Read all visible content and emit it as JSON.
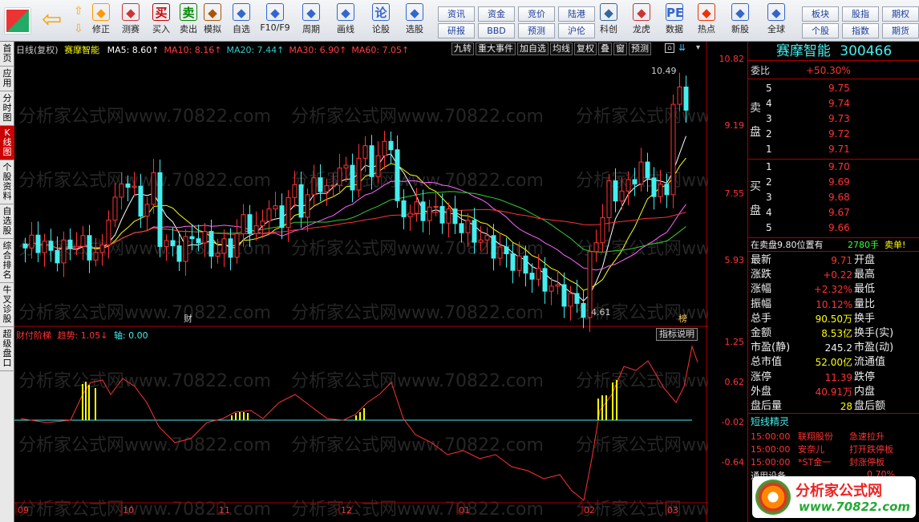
{
  "toolbar": {
    "big": [
      {
        "label": "修正",
        "icon": "sun-icon"
      },
      {
        "label": "测赛",
        "icon": "clock-icon"
      },
      {
        "label": "买入",
        "icon": "buy-icon",
        "glyph": "买"
      },
      {
        "label": "卖出",
        "icon": "sell-icon",
        "glyph": "卖"
      },
      {
        "label": "模拟",
        "icon": "hammer-icon"
      },
      {
        "label": "自选",
        "icon": "star-icon"
      },
      {
        "label": "F10/F9",
        "icon": "f10-icon"
      },
      {
        "label": "周期",
        "icon": "period-icon"
      },
      {
        "label": "画线",
        "icon": "pen-icon"
      },
      {
        "label": "论股",
        "icon": "discuss-icon",
        "glyph": "论"
      },
      {
        "label": "选股",
        "icon": "select-icon"
      },
      {
        "label": "科创",
        "icon": "kechuang-icon"
      },
      {
        "label": "龙虎",
        "icon": "dragon-icon"
      },
      {
        "label": "数据",
        "icon": "pe-icon",
        "glyph": "PE"
      },
      {
        "label": "热点",
        "icon": "fire-icon"
      },
      {
        "label": "新股",
        "icon": "ipo-icon"
      },
      {
        "label": "全球",
        "icon": "globe-icon"
      }
    ],
    "small": [
      "资讯",
      "资金",
      "竞价",
      "陆港",
      "研报",
      "BBD",
      "预测",
      "沪伦",
      "板块",
      "股指",
      "期权",
      "个股",
      "指数",
      "期货"
    ]
  },
  "leftbar": [
    {
      "label": "首页"
    },
    {
      "label": "应用"
    },
    {
      "label": "分时图"
    },
    {
      "label": "K线图",
      "active": true
    },
    {
      "label": "个股资料"
    },
    {
      "label": "自选股"
    },
    {
      "label": "综合排名"
    },
    {
      "label": "牛叉诊股"
    },
    {
      "label": "超级盘口"
    }
  ],
  "chart_header": {
    "mode": "日线(复权)",
    "name": "赛摩智能",
    "ma": [
      {
        "label": "MA5: 8.60↑",
        "color": "#ffffff"
      },
      {
        "label": "MA10: 8.16↑",
        "color": "#ff4040"
      },
      {
        "label": "MA20: 7.44↑",
        "color": "#33cccc"
      },
      {
        "label": "MA30: 6.90↑",
        "color": "#ff4040"
      },
      {
        "label": "MA60: 7.05↑",
        "color": "#ff4040"
      }
    ]
  },
  "chart_buttons": [
    "九转",
    "重大事件",
    "加自选",
    "均线",
    "复权",
    "叠",
    "窗",
    "预测"
  ],
  "main_axis": [
    "10.82",
    "9.19",
    "7.55",
    "5.93"
  ],
  "high_label": "10.49",
  "low_label": "4.61",
  "marker_cai": "财",
  "marker_bang": "榜",
  "indicator": {
    "title": "财付阶梯",
    "trend_label": "趋势:",
    "trend_value": "1.05↓",
    "axis_label": "轴:",
    "axis_value": "0.00",
    "explain": "指标说明"
  },
  "sub_axis": [
    "1.25",
    "0.62",
    "-0.02",
    "-0.64"
  ],
  "months": [
    "09",
    "10",
    "11",
    "12",
    "01",
    "02",
    "03"
  ],
  "watermark": "分析家公式网www.70822.com",
  "stock": {
    "name": "赛摩智能",
    "code": "300466"
  },
  "weibi": {
    "label": "委比",
    "value": "+50.30%"
  },
  "sell": [
    {
      "n": "5",
      "p": "9.75"
    },
    {
      "n": "4",
      "p": "9.74"
    },
    {
      "n": "3",
      "p": "9.73"
    },
    {
      "n": "2",
      "p": "9.72"
    },
    {
      "n": "1",
      "p": "9.71"
    }
  ],
  "buy": [
    {
      "n": "1",
      "p": "9.70"
    },
    {
      "n": "2",
      "p": "9.69"
    },
    {
      "n": "3",
      "p": "9.68"
    },
    {
      "n": "4",
      "p": "9.67"
    },
    {
      "n": "5",
      "p": "9.66"
    }
  ],
  "sell_label": [
    "卖",
    "盘"
  ],
  "buy_label": [
    "买",
    "盘"
  ],
  "order_note": {
    "text": "在卖盘9.80位置有",
    "qty": "2780手",
    "action": "卖单!"
  },
  "quote": [
    {
      "k": "最新",
      "v": "9.71",
      "k2": "开盘",
      "v2": ""
    },
    {
      "k": "涨跌",
      "v": "+0.22",
      "k2": "最高",
      "v2": ""
    },
    {
      "k": "涨幅",
      "v": "+2.32%",
      "k2": "最低",
      "v2": ""
    },
    {
      "k": "振幅",
      "v": "10.12%",
      "k2": "量比",
      "v2": ""
    },
    {
      "k": "总手",
      "v": "90.50万",
      "k2": "换手",
      "v2": ""
    },
    {
      "k": "金额",
      "v": "8.53亿",
      "k2": "换手(实)",
      "v2": ""
    },
    {
      "k": "市盈(静)",
      "v": "245.2",
      "k2": "市盈(动)",
      "v2": ""
    },
    {
      "k": "总市值",
      "v": "52.00亿",
      "k2": "流通值",
      "v2": ""
    },
    {
      "k": "涨停",
      "v": "11.39",
      "k2": "跌停",
      "v2": ""
    },
    {
      "k": "外盘",
      "v": "40.91万",
      "k2": "内盘",
      "v2": ""
    },
    {
      "k": "盘后量",
      "v": "28",
      "k2": "盘后额",
      "v2": ""
    }
  ],
  "elves": {
    "title": "短线精灵",
    "rows": [
      {
        "t": "15:00:00",
        "s": "联翔股份",
        "e": "急速拉升"
      },
      {
        "t": "15:00:00",
        "s": "安奈儿",
        "e": "打开跌停板"
      },
      {
        "t": "15:00:00",
        "s": "*ST金一",
        "e": "封涨停板"
      }
    ]
  },
  "footer": {
    "partial": "通用设备",
    "pct": "0.70%"
  },
  "logo": {
    "title": "分析家公式网",
    "url": "www.70822.com"
  }
}
